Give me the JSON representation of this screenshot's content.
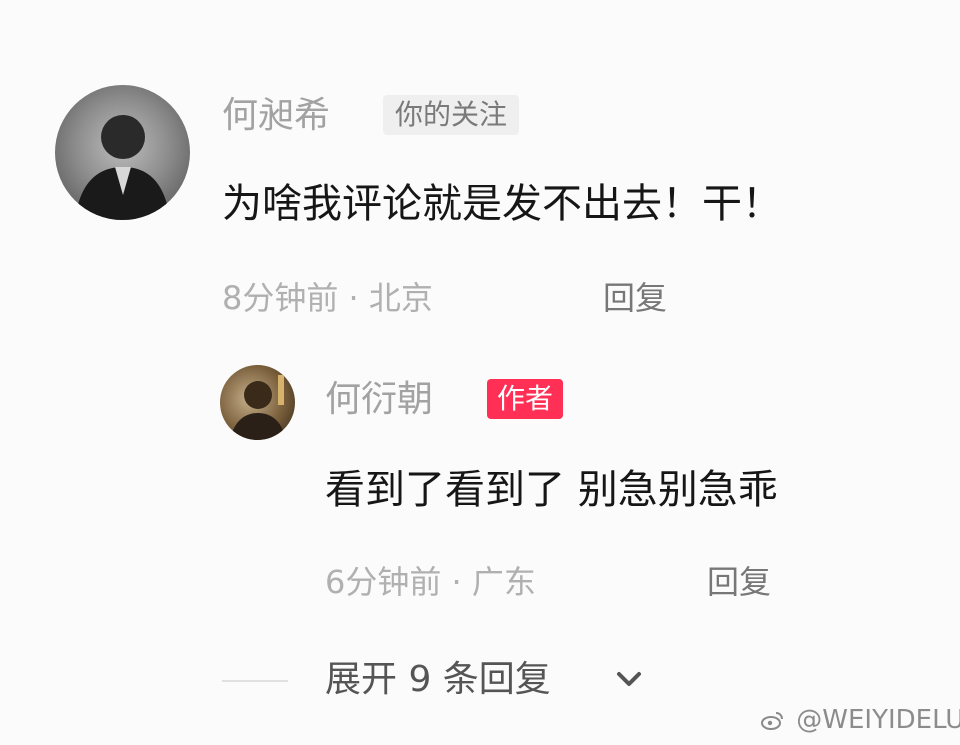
{
  "comments": [
    {
      "author": "何昶希",
      "badge": "你的关注",
      "text": "为啥我评论就是发不出去！干！",
      "meta": "8分钟前 · 北京",
      "reply_label": "回复",
      "avatar_icon": "avatar-photo-bw"
    }
  ],
  "reply": {
    "author": "何衍朝",
    "badge": "作者",
    "text": "看到了看到了 别急别急乖",
    "meta": "6分钟前 · 广东",
    "reply_label": "回复",
    "avatar_icon": "avatar-photo-color"
  },
  "expand": {
    "label": "展开 9 条回复",
    "icon": "chevron-down-icon"
  },
  "watermark": {
    "text": "@WEIYIDELU",
    "icon": "weibo-icon"
  },
  "colors": {
    "author_badge_bg": "#ff2f55",
    "follow_badge_bg": "#efefef",
    "meta_text": "#b0b0b0"
  }
}
